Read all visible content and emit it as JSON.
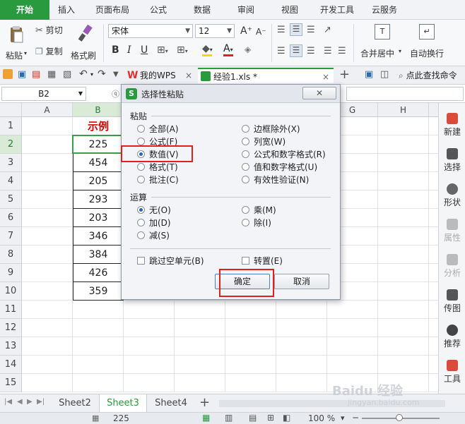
{
  "menu_tabs": [
    "开始",
    "插入",
    "页面布局",
    "公式",
    "数据",
    "审阅",
    "视图",
    "开发工具",
    "云服务"
  ],
  "ribbon": {
    "paste_label": "粘贴",
    "cut_label": "剪切",
    "copy_label": "复制",
    "format_painter_label": "格式刷",
    "font_name": "宋体",
    "font_size": "12",
    "bold": "B",
    "italic": "I",
    "underline": "U",
    "increase_font": "A⁺",
    "decrease_font": "A⁻",
    "merge_center_label": "合并居中",
    "wrap_text_label": "自动换行"
  },
  "doc_tabs": {
    "wps_home": "我的WPS",
    "workbook": "经验1.xls *",
    "search_label": "点此查找命令"
  },
  "formula_bar": {
    "name_box": "B2"
  },
  "grid": {
    "columns": [
      "A",
      "B",
      "",
      "",
      "",
      "",
      "G",
      "H"
    ],
    "rows": [
      "1",
      "2",
      "3",
      "4",
      "5",
      "6",
      "7",
      "8",
      "9",
      "10",
      "11",
      "12",
      "13",
      "14",
      "15"
    ],
    "header_cell": "示例",
    "values": [
      "225",
      "454",
      "205",
      "293",
      "203",
      "346",
      "384",
      "426",
      "359"
    ]
  },
  "right_panel": [
    "新建",
    "选择",
    "形状",
    "属性",
    "分析",
    "传图",
    "推荐",
    "工具"
  ],
  "sheet_tabs": [
    "Sheet2",
    "Sheet3",
    "Sheet4"
  ],
  "active_sheet": "Sheet3",
  "status": {
    "sum_value": "225",
    "zoom": "100 %"
  },
  "dialog": {
    "title": "选择性粘贴",
    "paste_group": "粘贴",
    "paste_options": [
      "全部(A)",
      "公式(F)",
      "数值(V)",
      "格式(T)",
      "批注(C)",
      "边框除外(X)",
      "列宽(W)",
      "公式和数字格式(R)",
      "值和数字格式(U)",
      "有效性验证(N)"
    ],
    "paste_selected": "数值(V)",
    "operation_group": "运算",
    "operation_options": [
      "无(O)",
      "加(D)",
      "减(S)",
      "乘(M)",
      "除(I)"
    ],
    "operation_selected": "无(O)",
    "skip_blanks": "跳过空单元(B)",
    "transpose": "转置(E)",
    "ok_label": "确定",
    "cancel_label": "取消"
  },
  "watermark": {
    "line1": "Baidu 经验",
    "line2": "jingyan.baidu.com"
  },
  "colors": {
    "accent_green": "#2a9a3f",
    "highlight_red": "#e02020",
    "header_text_red": "#d40000"
  }
}
